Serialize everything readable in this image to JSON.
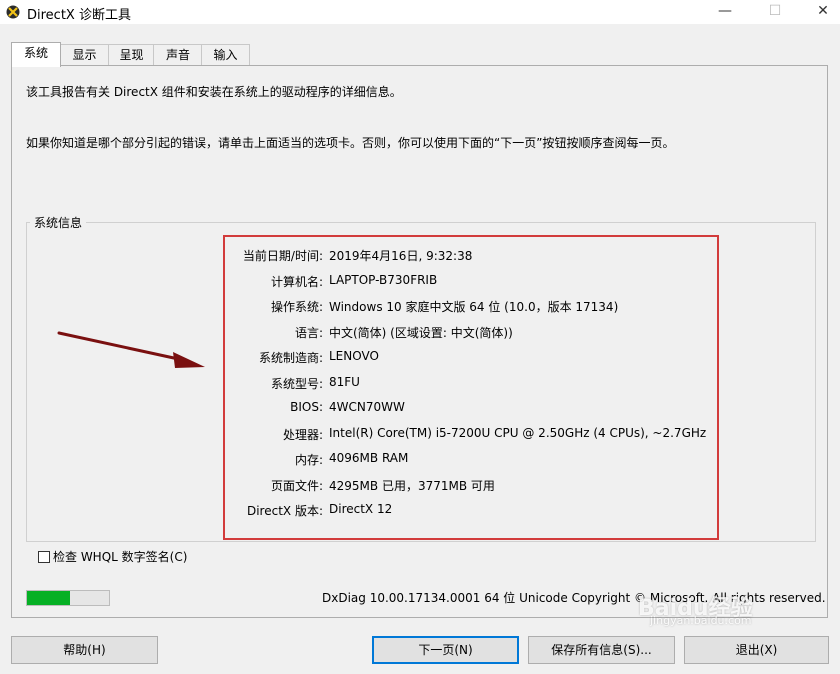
{
  "window": {
    "title": "DirectX 诊断工具",
    "min_glyph": "—",
    "max_glyph": "☐",
    "close_glyph": "✕"
  },
  "tabs": [
    {
      "label": "系统",
      "active": true
    },
    {
      "label": "显示",
      "active": false
    },
    {
      "label": "呈现",
      "active": false
    },
    {
      "label": "声音",
      "active": false
    },
    {
      "label": "输入",
      "active": false
    }
  ],
  "intro": {
    "line1": "该工具报告有关 DirectX 组件和安装在系统上的驱动程序的详细信息。",
    "line2": "如果你知道是哪个部分引起的错误，请单击上面适当的选项卡。否则，你可以使用下面的“下一页”按钮按顺序查阅每一页。"
  },
  "system_info": {
    "group_title": "系统信息",
    "rows": [
      {
        "label": "当前日期/时间:",
        "value": "2019年4月16日, 9:32:38"
      },
      {
        "label": "计算机名:",
        "value": "LAPTOP-B730FRIB"
      },
      {
        "label": "操作系统:",
        "value": "Windows 10 家庭中文版 64 位 (10.0，版本 17134)"
      },
      {
        "label": "语言:",
        "value": "中文(简体) (区域设置: 中文(简体))"
      },
      {
        "label": "系统制造商:",
        "value": "LENOVO"
      },
      {
        "label": "系统型号:",
        "value": "81FU"
      },
      {
        "label": "BIOS:",
        "value": "4WCN70WW"
      },
      {
        "label": "处理器:",
        "value": "Intel(R) Core(TM) i5-7200U CPU @ 2.50GHz (4 CPUs), ~2.7GHz"
      },
      {
        "label": "内存:",
        "value": "4096MB RAM"
      },
      {
        "label": "页面文件:",
        "value": "4295MB 已用，3771MB 可用"
      },
      {
        "label": "DirectX 版本:",
        "value": "DirectX 12"
      }
    ]
  },
  "whql": {
    "label": "检查 WHQL 数字签名(C)",
    "checked": false
  },
  "progress": {
    "fraction": 0.53,
    "color": "#06b025"
  },
  "footer": {
    "text": "DxDiag 10.00.17134.0001 64 位 Unicode  Copyright © Microsoft. All rights reserved."
  },
  "buttons": {
    "help": "帮助(H)",
    "next": "下一页(N)",
    "save": "保存所有信息(S)...",
    "exit": "退出(X)"
  },
  "watermark": {
    "brand": "Baidu经验",
    "url": "jingyan.baidu.com"
  },
  "colors": {
    "highlight_box": "#d23b3b",
    "arrow": "#7a1010",
    "default_button_border": "#0078d7"
  }
}
